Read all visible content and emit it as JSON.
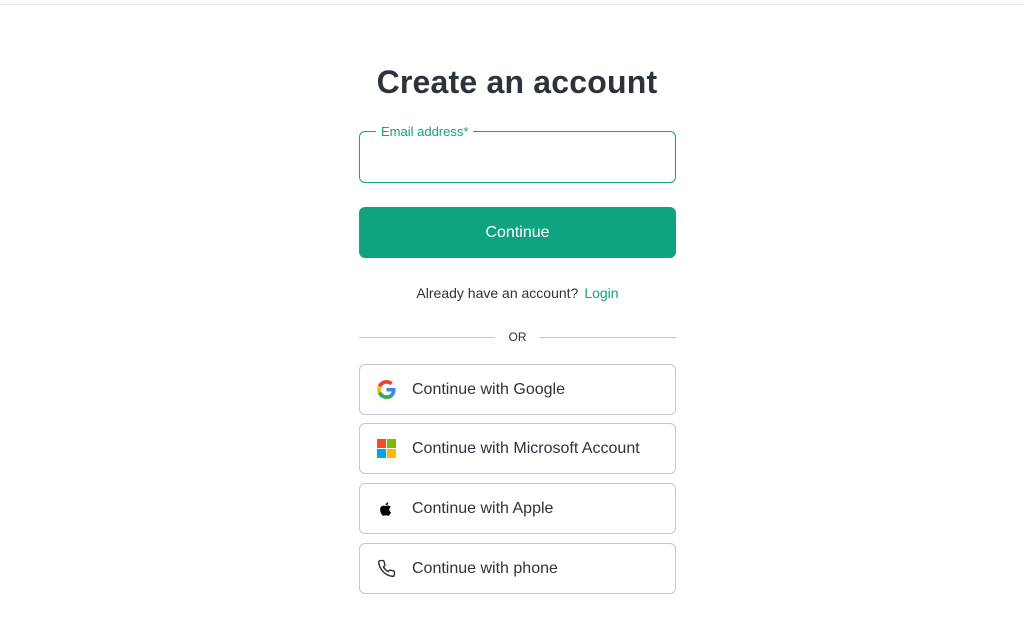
{
  "page": {
    "title": "Create an account"
  },
  "email": {
    "label": "Email address*",
    "value": "",
    "placeholder": ""
  },
  "continue_label": "Continue",
  "login_prompt": {
    "text": "Already have an account?",
    "link": "Login"
  },
  "divider_text": "OR",
  "social": [
    {
      "label": "Continue with Google",
      "icon": "google-icon"
    },
    {
      "label": "Continue with Microsoft Account",
      "icon": "microsoft-icon"
    },
    {
      "label": "Continue with Apple",
      "icon": "apple-icon"
    },
    {
      "label": "Continue with phone",
      "icon": "phone-icon"
    }
  ],
  "colors": {
    "accent": "#10a37f",
    "text": "#2d333a",
    "border": "#c2c8d0"
  }
}
